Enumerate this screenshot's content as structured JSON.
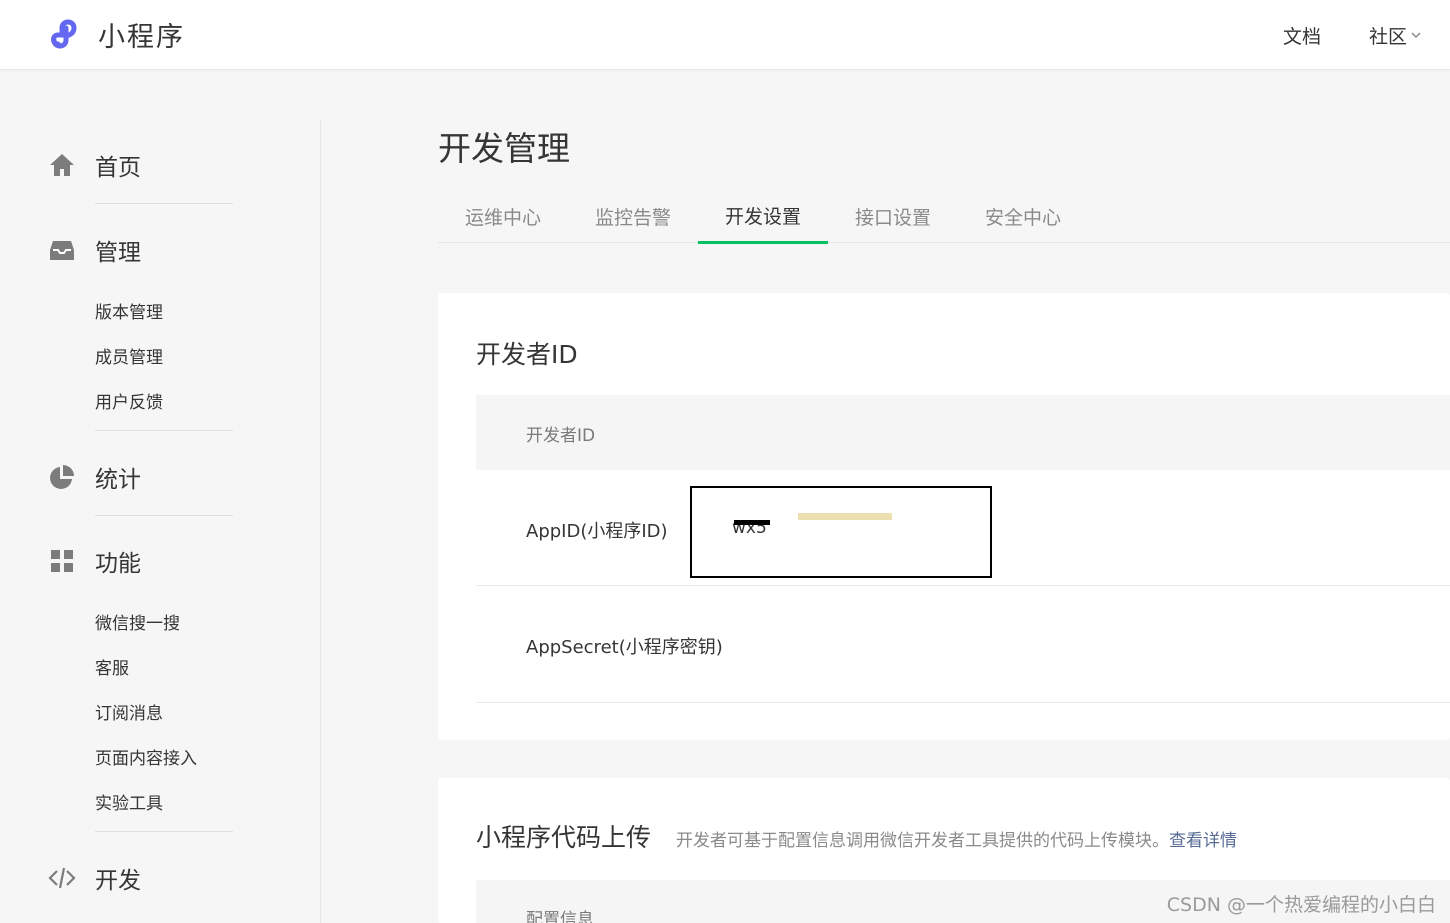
{
  "header": {
    "brand": "小程序",
    "nav": [
      {
        "label": "文档"
      },
      {
        "label": "社区"
      }
    ]
  },
  "sidebar": {
    "groups": [
      {
        "label": "首页",
        "icon": "home-icon",
        "items": []
      },
      {
        "label": "管理",
        "icon": "inbox-icon",
        "items": [
          "版本管理",
          "成员管理",
          "用户反馈"
        ]
      },
      {
        "label": "统计",
        "icon": "pie-chart-icon",
        "items": []
      },
      {
        "label": "功能",
        "icon": "grid-icon",
        "items": [
          "微信搜一搜",
          "客服",
          "订阅消息",
          "页面内容接入",
          "实验工具"
        ]
      },
      {
        "label": "开发",
        "icon": "code-icon",
        "items": []
      }
    ]
  },
  "main": {
    "title": "开发管理",
    "tabs": [
      {
        "label": "运维中心",
        "active": false
      },
      {
        "label": "监控告警",
        "active": false
      },
      {
        "label": "开发设置",
        "active": true
      },
      {
        "label": "接口设置",
        "active": false
      },
      {
        "label": "安全中心",
        "active": false
      }
    ],
    "developer_card": {
      "title": "开发者ID",
      "table_header": "开发者ID",
      "rows": [
        {
          "label": "AppID(小程序ID)",
          "value": "wx5"
        },
        {
          "label": "AppSecret(小程序密钥)",
          "value": ""
        }
      ]
    },
    "upload_card": {
      "title": "小程序代码上传",
      "description": "开发者可基于配置信息调用微信开发者工具提供的代码上传模块。",
      "link": "查看详情",
      "table_header": "配置信息"
    }
  },
  "watermark": "CSDN @一个热爱编程的小白白",
  "colors": {
    "accent": "#07c160",
    "link": "#576b95",
    "brand_logo": "#6467f0",
    "background": "#f6f6f6"
  }
}
